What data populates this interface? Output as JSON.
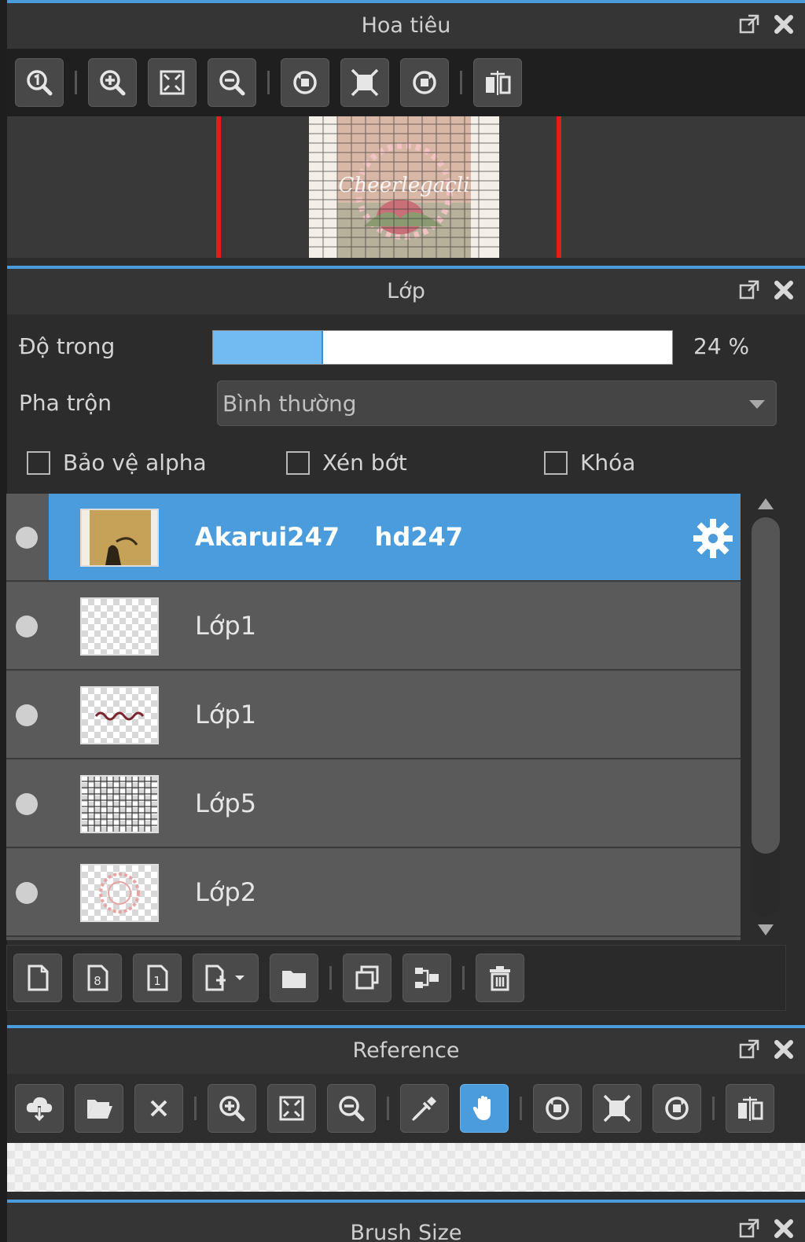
{
  "navigator": {
    "title": "Hoa tiêu",
    "toolbar": [
      "zoom-reset-icon",
      "zoom-in-icon",
      "fit-window-icon",
      "zoom-out-icon",
      "rotate-left-icon",
      "fit-screen-icon",
      "rotate-right-icon",
      "flip-horizontal-icon"
    ],
    "thumbnail_text": "Cheerlegacli"
  },
  "layers_panel": {
    "title": "Lớp",
    "opacity": {
      "label": "Độ trong",
      "value": 24,
      "display": "24 %"
    },
    "blend": {
      "label": "Pha trộn",
      "value": "Bình thường"
    },
    "checks": [
      {
        "label": "Bảo vệ alpha",
        "checked": false
      },
      {
        "label": "Xén bớt",
        "checked": false
      },
      {
        "label": "Khóa",
        "checked": false
      }
    ],
    "layers": [
      {
        "name": "Akarui247    hd247",
        "selected": true,
        "thumb": "photo"
      },
      {
        "name": "Lớp1",
        "selected": false,
        "thumb": "blank"
      },
      {
        "name": "Lớp1",
        "selected": false,
        "thumb": "text"
      },
      {
        "name": "Lớp5",
        "selected": false,
        "thumb": "grid"
      },
      {
        "name": "Lớp2",
        "selected": false,
        "thumb": "circle"
      }
    ],
    "scroll_fraction": 0.0
  },
  "reference": {
    "title": "Reference"
  },
  "brush_size": {
    "title": "Brush Size"
  },
  "colors": {
    "accent": "#4a9cdd",
    "red_guide": "#e01e1e"
  }
}
